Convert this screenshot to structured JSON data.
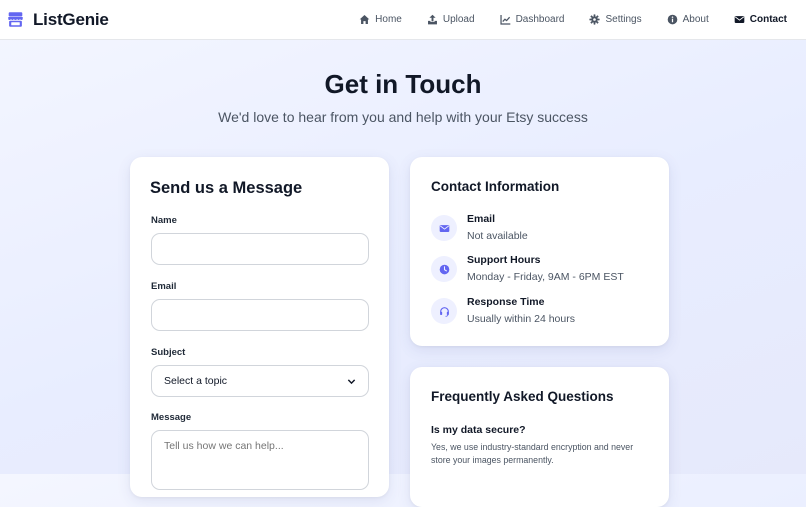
{
  "brand": {
    "name": "ListGenie",
    "icon": "store-icon",
    "color": "#6366f1"
  },
  "nav": {
    "items": [
      {
        "label": "Home",
        "icon": "home-icon"
      },
      {
        "label": "Upload",
        "icon": "upload-icon"
      },
      {
        "label": "Dashboard",
        "icon": "chart-line-icon"
      },
      {
        "label": "Settings",
        "icon": "gear-icon"
      },
      {
        "label": "About",
        "icon": "info-icon"
      },
      {
        "label": "Contact",
        "icon": "envelope-icon",
        "active": true
      }
    ]
  },
  "hero": {
    "title": "Get in Touch",
    "subtitle": "We'd love to hear from you and help with your Etsy success"
  },
  "form": {
    "title": "Send us a Message",
    "name": {
      "label": "Name",
      "value": "",
      "placeholder": ""
    },
    "email": {
      "label": "Email",
      "value": "",
      "placeholder": ""
    },
    "subject": {
      "label": "Subject",
      "selected": "Select a topic"
    },
    "message": {
      "label": "Message",
      "value": "",
      "placeholder": "Tell us how we can help..."
    }
  },
  "contact_info": {
    "title": "Contact Information",
    "items": [
      {
        "label": "Email",
        "value": "Not available",
        "icon": "envelope-icon"
      },
      {
        "label": "Support Hours",
        "value": "Monday - Friday, 9AM - 6PM EST",
        "icon": "clock-icon"
      },
      {
        "label": "Response Time",
        "value": "Usually within 24 hours",
        "icon": "headset-icon"
      }
    ]
  },
  "faq": {
    "title": "Frequently Asked Questions",
    "items": [
      {
        "question": "Is my data secure?",
        "answer": "Yes, we use industry-standard encryption and never store your images permanently."
      }
    ]
  },
  "colors": {
    "accent": "#6366f1",
    "accent_soft": "#eef0ff",
    "text": "#111827",
    "muted": "#4b5563"
  }
}
